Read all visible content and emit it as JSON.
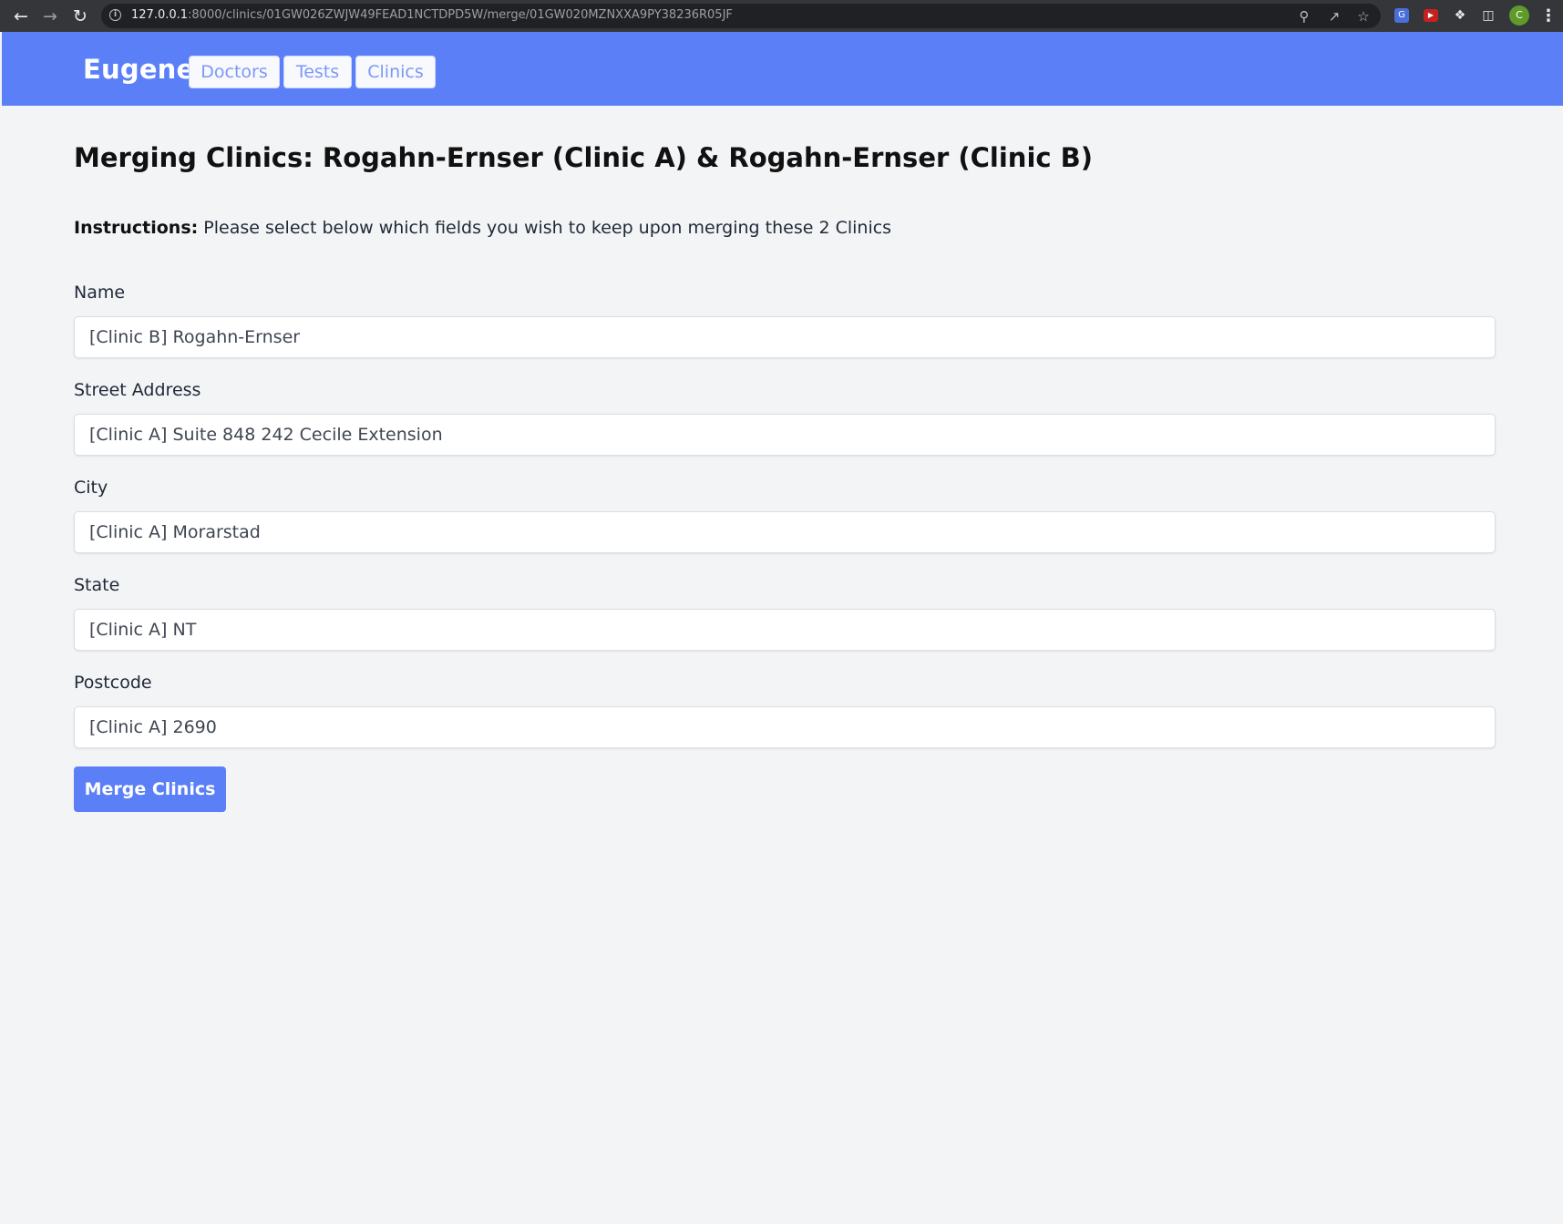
{
  "browser": {
    "url_host": "127.0.0.1",
    "url_rest": ":8000/clinics/01GW026ZWJW49FEAD1NCTDPD5W/merge/01GW020MZNXXA9PY38236R05JF",
    "avatar_initial": "C"
  },
  "header": {
    "brand": "Eugene",
    "nav": [
      "Doctors",
      "Tests",
      "Clinics"
    ]
  },
  "main": {
    "title": "Merging Clinics: Rogahn-Ernser (Clinic A) & Rogahn-Ernser (Clinic B)",
    "instructions_label": "Instructions:",
    "instructions_text": " Please select below which fields you wish to keep upon merging these 2 Clinics",
    "fields": [
      {
        "label": "Name",
        "value": "[Clinic B] Rogahn-Ernser"
      },
      {
        "label": "Street Address",
        "value": "[Clinic A] Suite 848 242 Cecile Extension"
      },
      {
        "label": "City",
        "value": "[Clinic A] Morarstad"
      },
      {
        "label": "State",
        "value": "[Clinic A] NT"
      },
      {
        "label": "Postcode",
        "value": "[Clinic A] 2690"
      }
    ],
    "submit_label": "Merge Clinics"
  }
}
